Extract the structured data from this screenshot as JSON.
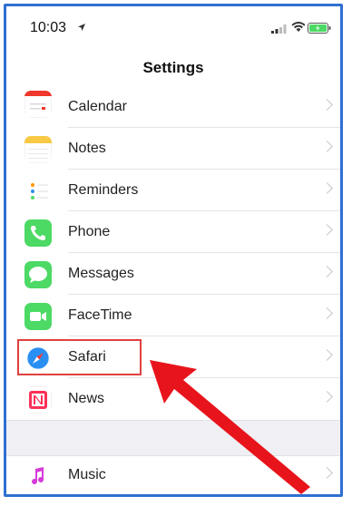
{
  "status_bar": {
    "time": "10:03",
    "icons": [
      "location-arrow-icon",
      "signal-icon",
      "wifi-icon",
      "battery-icon"
    ]
  },
  "nav": {
    "title": "Settings"
  },
  "rows": [
    {
      "label": "Calendar",
      "icon": "calendar-icon"
    },
    {
      "label": "Notes",
      "icon": "notes-icon"
    },
    {
      "label": "Reminders",
      "icon": "reminders-icon"
    },
    {
      "label": "Phone",
      "icon": "phone-icon"
    },
    {
      "label": "Messages",
      "icon": "messages-icon"
    },
    {
      "label": "FaceTime",
      "icon": "facetime-icon"
    },
    {
      "label": "Safari",
      "icon": "safari-icon"
    },
    {
      "label": "News",
      "icon": "news-icon"
    },
    {
      "label": "Music",
      "icon": "music-icon"
    }
  ],
  "annotation": {
    "highlight_color": "#e04040",
    "arrow_color": "#e8141b",
    "frame_color": "#2f6fd1"
  }
}
